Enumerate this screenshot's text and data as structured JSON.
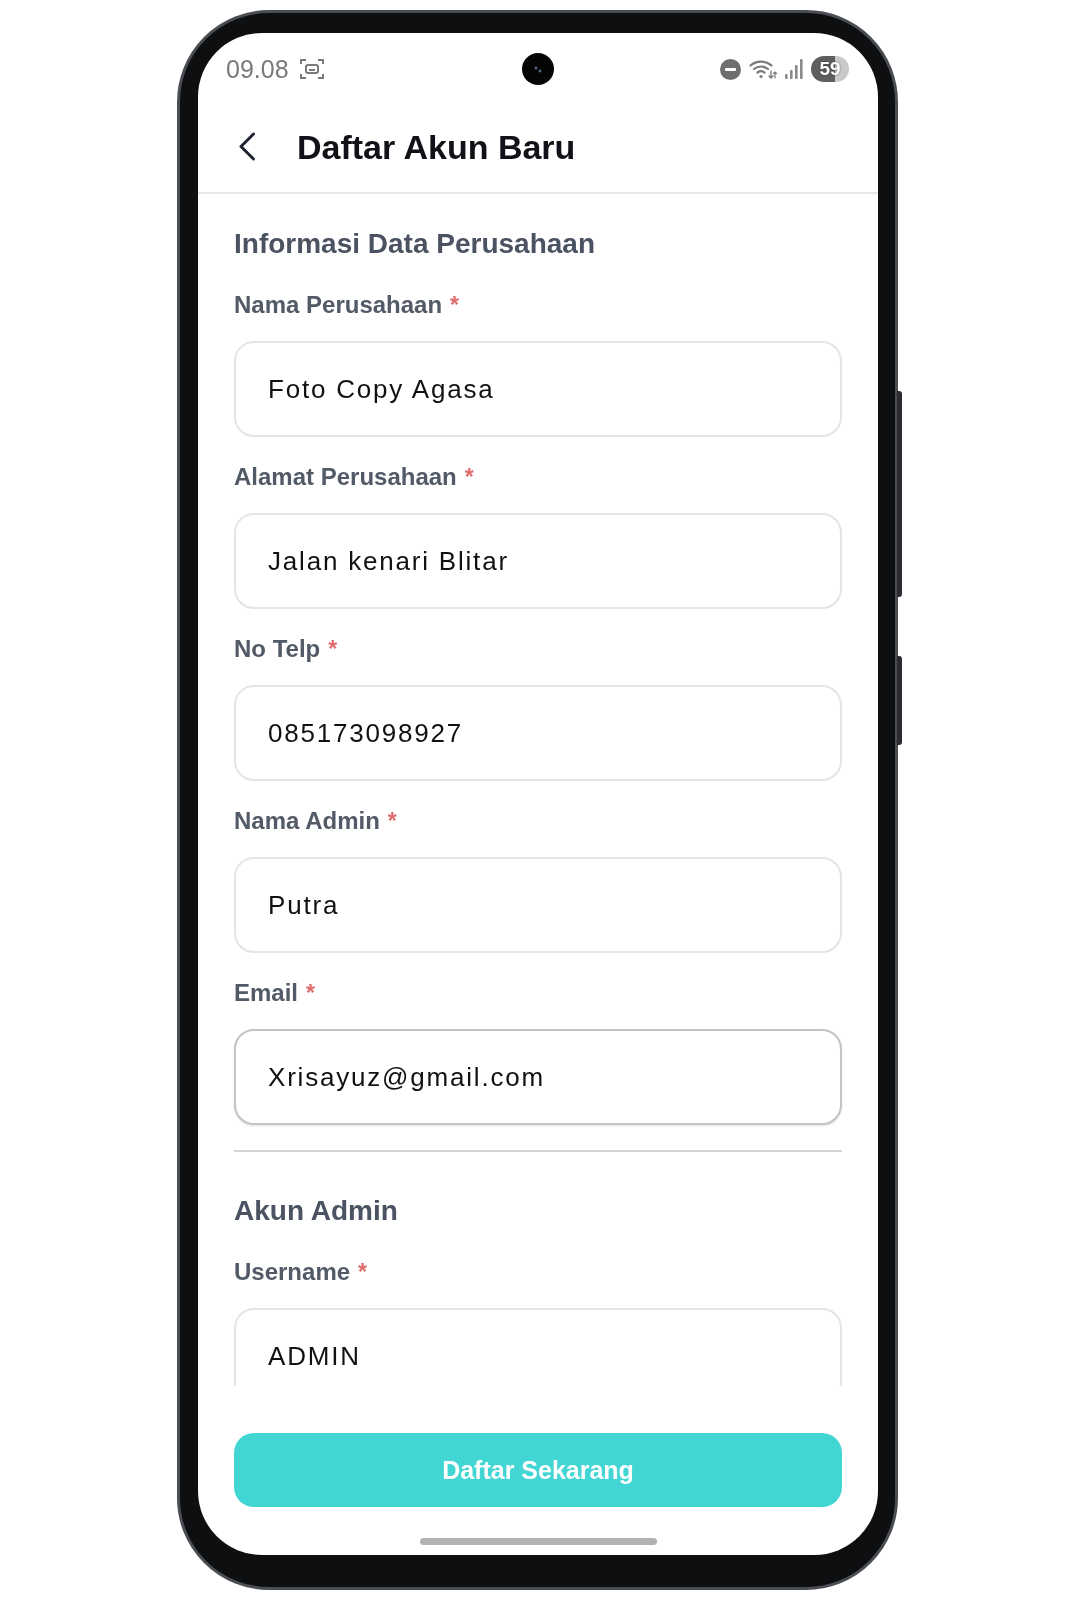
{
  "status_bar": {
    "time": "09.08",
    "battery": "59"
  },
  "header": {
    "title": "Daftar Akun Baru"
  },
  "sections": [
    {
      "title": "Informasi Data Perusahaan",
      "fields": [
        {
          "label": "Nama Perusahaan",
          "required_mark": "*",
          "value": "Foto Copy Agasa",
          "focused": false
        },
        {
          "label": "Alamat Perusahaan",
          "required_mark": "*",
          "value": "Jalan kenari Blitar",
          "focused": false
        },
        {
          "label": "No Telp",
          "required_mark": "*",
          "value": "085173098927",
          "focused": false
        },
        {
          "label": "Nama Admin",
          "required_mark": "*",
          "value": "Putra",
          "focused": false
        },
        {
          "label": "Email",
          "required_mark": "*",
          "value": "Xrisayuz@gmail.com",
          "focused": true
        }
      ]
    },
    {
      "title": "Akun Admin",
      "fields": [
        {
          "label": "Username",
          "required_mark": "*",
          "value": "ADMIN",
          "focused": false
        }
      ]
    }
  ],
  "submit_button": {
    "label": "Daftar Sekarang"
  }
}
